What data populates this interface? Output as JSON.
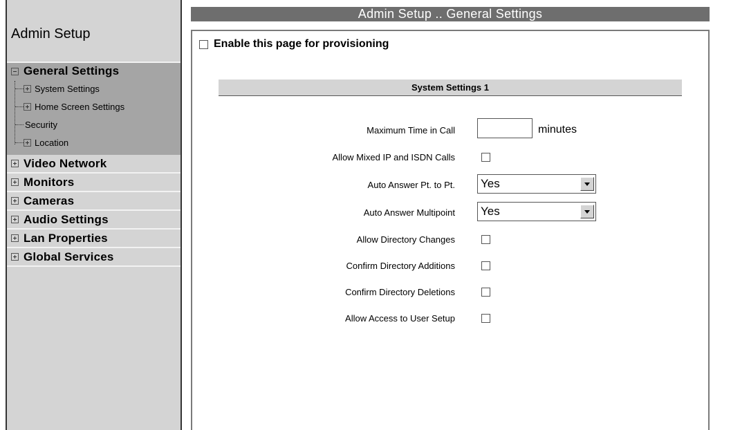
{
  "sidebar": {
    "title": "Admin Setup",
    "expanded_group": {
      "label": "General Settings",
      "children": [
        "System Settings",
        "Home Screen Settings",
        "Security",
        "Location"
      ]
    },
    "groups": [
      "Video Network",
      "Monitors",
      "Cameras",
      "Audio Settings",
      "Lan Properties",
      "Global Services"
    ]
  },
  "header": {
    "title": "Admin Setup .. General Settings"
  },
  "provision": {
    "label": "Enable this page for provisioning"
  },
  "section": {
    "title": "System Settings 1"
  },
  "fields": {
    "max_time": {
      "label": "Maximum Time in Call",
      "value": "",
      "units": "minutes"
    },
    "mixed_calls": {
      "label": "Allow Mixed IP and ISDN Calls"
    },
    "auto_pt": {
      "label": "Auto Answer Pt. to Pt.",
      "value": "Yes"
    },
    "auto_multi": {
      "label": "Auto Answer Multipoint",
      "value": "Yes"
    },
    "dir_changes": {
      "label": "Allow Directory Changes"
    },
    "dir_add": {
      "label": "Confirm Directory Additions"
    },
    "dir_del": {
      "label": "Confirm Directory Deletions"
    },
    "user_setup": {
      "label": "Allow Access to User Setup"
    }
  }
}
